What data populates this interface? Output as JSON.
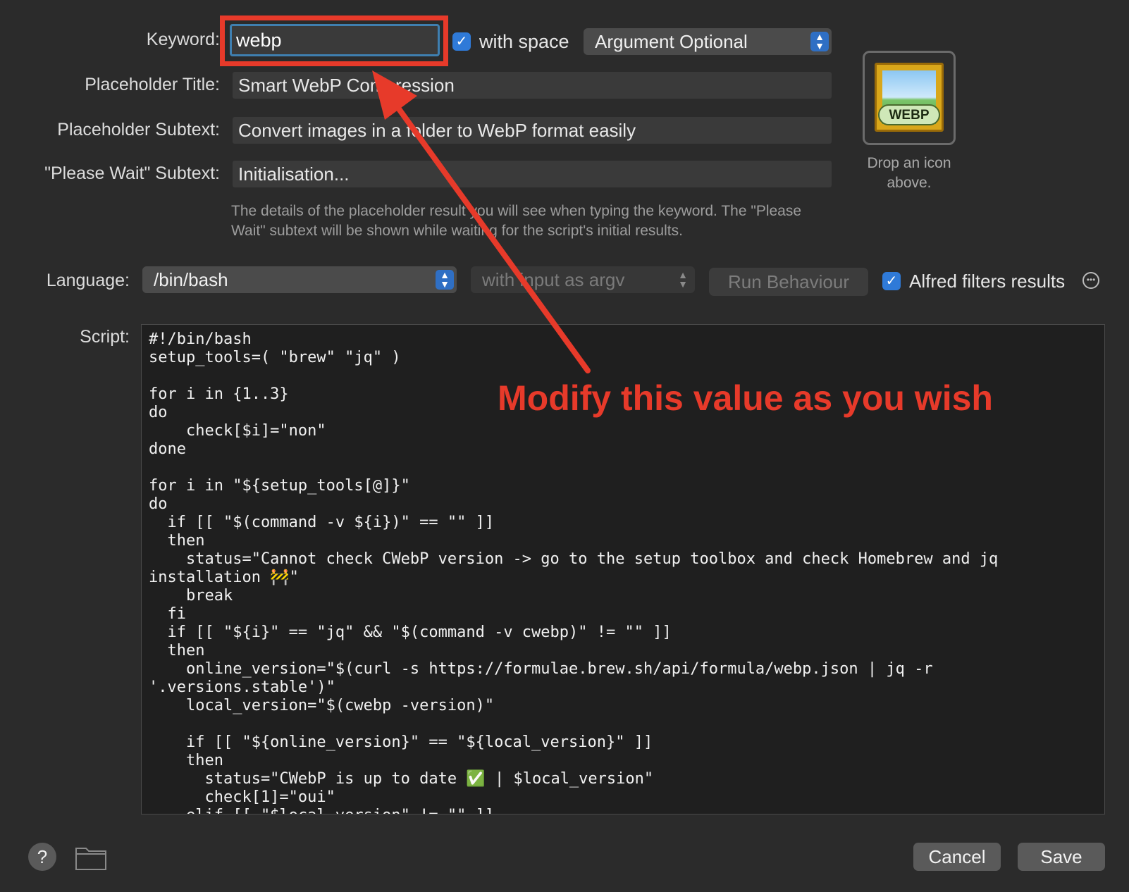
{
  "form": {
    "keyword_label": "Keyword:",
    "keyword_value": "webp",
    "with_space_label": "with space",
    "argument_select": "Argument Optional",
    "placeholder_title_label": "Placeholder Title:",
    "placeholder_title_value": "Smart WebP Compression",
    "placeholder_subtext_label": "Placeholder Subtext:",
    "placeholder_subtext_value": "Convert images in a folder to WebP format easily",
    "please_wait_label": "\"Please Wait\" Subtext:",
    "please_wait_value": "Initialisation...",
    "help_text": "The details of the placeholder result you will see when typing the keyword. The \"Please Wait\" subtext will be shown while waiting for the script's initial results."
  },
  "icon_well": {
    "icon_text": "WEBP",
    "caption": "Drop an icon above."
  },
  "language_row": {
    "language_label": "Language:",
    "language_select": "/bin/bash",
    "input_select": "with input as argv",
    "run_behaviour_button": "Run Behaviour",
    "alfred_filters_label": "Alfred filters results"
  },
  "script": {
    "label": "Script:",
    "code": "#!/bin/bash\nsetup_tools=( \"brew\" \"jq\" )\n\nfor i in {1..3}\ndo\n    check[$i]=\"non\"\ndone\n\nfor i in \"${setup_tools[@]}\"\ndo\n  if [[ \"$(command -v ${i})\" == \"\" ]]\n  then\n    status=\"Cannot check CWebP version -> go to the setup toolbox and check Homebrew and jq\ninstallation 🚧\"\n    break\n  fi\n  if [[ \"${i}\" == \"jq\" && \"$(command -v cwebp)\" != \"\" ]]\n  then\n    online_version=\"$(curl -s https://formulae.brew.sh/api/formula/webp.json | jq -r\n'.versions.stable')\"\n    local_version=\"$(cwebp -version)\"\n\n    if [[ \"${online_version}\" == \"${local_version}\" ]]\n    then\n      status=\"CWebP is up to date ✅ | $local_version\"\n      check[1]=\"oui\"\n    elif [[ \"$local_version\" != \"\" ]]"
  },
  "annotation": {
    "text": "Modify this value as you wish",
    "color": "#e73a2a"
  },
  "footer": {
    "help_icon": "?",
    "cancel_button": "Cancel",
    "save_button": "Save"
  },
  "icons": [
    "checkmark-icon",
    "stepper-icon",
    "help-icon",
    "folder-icon",
    "more-icon",
    "webp-app-icon"
  ]
}
